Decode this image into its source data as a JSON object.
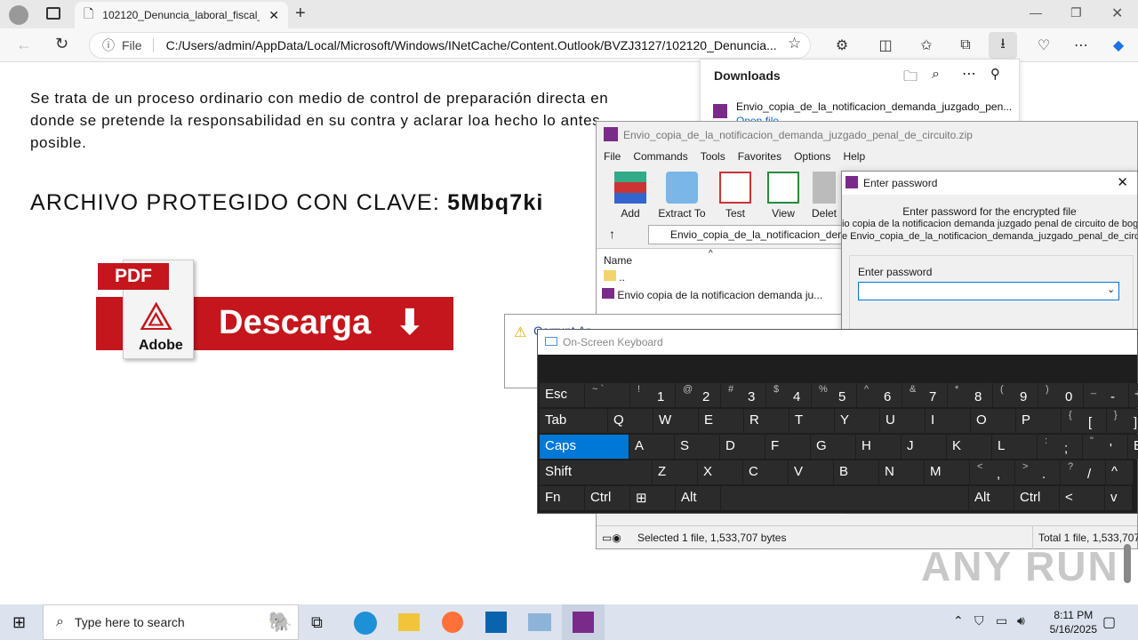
{
  "browser": {
    "tab_title": "102120_Denuncia_laboral_fiscal_j",
    "address_label": "File",
    "url": "C:/Users/admin/AppData/Local/Microsoft/Windows/INetCache/Content.Outlook/BVZJ3127/102120_Denuncia..."
  },
  "page": {
    "paragraph": "Se trata de un proceso ordinario con medio de control de preparación directa en donde se pretende la responsabilidad en su contra y aclarar loa hecho lo antes posible.",
    "clave_prefix": "ARCHIVO PROTEGIDO CON CLAVE: ",
    "clave_value": "5Mbq7ki",
    "banner_pdf": "PDF",
    "banner_text": "Descarga",
    "banner_adobe": "Adobe"
  },
  "downloads": {
    "title": "Downloads",
    "item": "Envio_copia_de_la_notificacion_demanda_juzgado_pen...",
    "item_action": "Open file"
  },
  "winrar": {
    "title": "Envio_copia_de_la_notificacion_demanda_juzgado_penal_de_circuito.zip",
    "menu": [
      "File",
      "Commands",
      "Tools",
      "Favorites",
      "Options",
      "Help"
    ],
    "tools": [
      "Add",
      "Extract To",
      "Test",
      "View",
      "Delet"
    ],
    "path": "Envio_copia_de_la_notificacion_dema",
    "col_name": "Name",
    "rows": [
      "..",
      "Envio copia de la notificacion demanda ju..."
    ],
    "status_left": "Selected 1 file, 1,533,707 bytes",
    "status_right": "Total 1 file, 1,533,707 b"
  },
  "password_dialog": {
    "title": "Enter password",
    "line1": "Enter password for the encrypted file",
    "line2": "io copia de la notificacion demanda juzgado penal de circuito de bogo",
    "line3": "e Envio_copia_de_la_notificacion_demanda_juzgado_penal_de_circ",
    "field_label": "Enter password",
    "value": ""
  },
  "warning": {
    "title": "Corrupt Ar"
  },
  "osk": {
    "title": "On-Screen Keyboard",
    "rows": [
      [
        "Esc",
        "~ `|",
        "!|1",
        "@|2",
        "#|3",
        "$|4",
        "%|5",
        "^|6",
        "&|7",
        "*|8",
        "(|9",
        ")|0",
        "_|-",
        "+"
      ],
      [
        "Tab",
        "Q",
        "W",
        "E",
        "R",
        "T",
        "Y",
        "U",
        "I",
        "O",
        "P",
        "{|[",
        "}|]"
      ],
      [
        "Caps",
        "A",
        "S",
        "D",
        "F",
        "G",
        "H",
        "J",
        "K",
        "L",
        ":|;",
        "\"|'",
        "E"
      ],
      [
        "Shift",
        "Z",
        "X",
        "C",
        "V",
        "B",
        "N",
        "M",
        "<|,",
        ">|.",
        "?|/",
        "^"
      ],
      [
        "Fn",
        "Ctrl",
        "⊞",
        "Alt",
        "",
        "Alt",
        "Ctrl",
        "<",
        "v"
      ]
    ]
  },
  "taskbar": {
    "search_placeholder": "Type here to search",
    "time": "8:11 PM",
    "date": "5/16/2025"
  },
  "watermark": "ANY RUN"
}
